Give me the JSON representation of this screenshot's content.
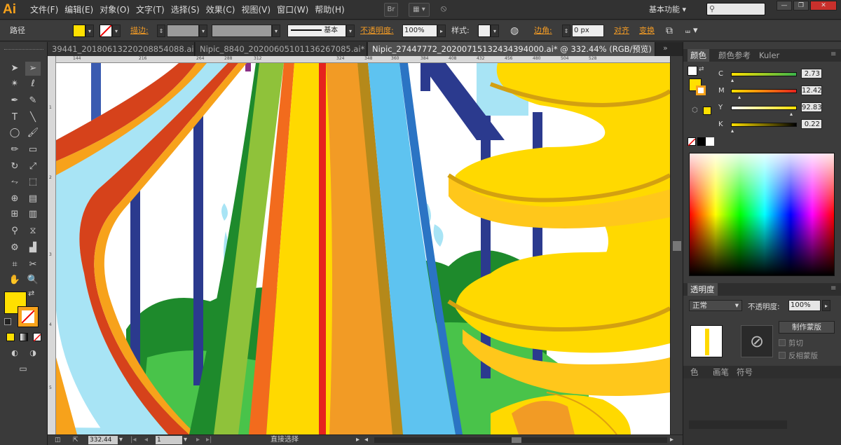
{
  "app": {
    "logo": "Ai"
  },
  "menu": [
    "文件(F)",
    "编辑(E)",
    "对象(O)",
    "文字(T)",
    "选择(S)",
    "效果(C)",
    "视图(V)",
    "窗口(W)",
    "帮助(H)"
  ],
  "menubar": {
    "bridge_label": "Br",
    "workspace": "基本功能",
    "search_placeholder": ""
  },
  "control_bar": {
    "selection_label": "路径",
    "stroke_label": "描边:",
    "stroke_style": "基本",
    "opacity_label": "不透明度:",
    "opacity_value": "100%",
    "style_label": "样式:",
    "corner_label": "边角:",
    "corner_value": "0 px",
    "align_label": "对齐",
    "transform_label": "变换"
  },
  "tabs": [
    {
      "label": "39441_20180613220208854088.ai*",
      "active": false
    },
    {
      "label": "Nipic_8840_20200605101136267085.ai*",
      "active": false
    },
    {
      "label": "Nipic_27447772_20200715132434394000.ai* @ 332.44% (RGB/预览)",
      "active": true
    }
  ],
  "ruler_top": [
    "144",
    "216",
    "264",
    "288",
    "312",
    "324",
    "348",
    "360",
    "384",
    "408",
    "432",
    "456",
    "480",
    "504",
    "528"
  ],
  "ruler_left": [
    "1",
    "2",
    "3",
    "4",
    "5"
  ],
  "status": {
    "zoom": "332.44",
    "artboard": "1",
    "tool": "直接选择"
  },
  "panels": {
    "color_tabs": [
      "颜色",
      "颜色参考",
      "Kuler"
    ],
    "cmyk": [
      {
        "label": "C",
        "value": "2.73",
        "level": 0.027
      },
      {
        "label": "M",
        "value": "12.42",
        "level": 0.124
      },
      {
        "label": "Y",
        "value": "92.83",
        "level": 0.928
      },
      {
        "label": "K",
        "value": "0.22",
        "level": 0.002
      }
    ],
    "transparency_tab": "透明度",
    "blend_mode": "正常",
    "opacity_label": "不透明度:",
    "opacity_value": "100%",
    "make_mask": "制作蒙版",
    "clip": "剪切",
    "invert_mask": "反相蒙版",
    "bottom_tabs": [
      "色",
      "画笔",
      "符号"
    ]
  },
  "colors": {
    "fill": "#ffe000",
    "stroke": "#f7a21b"
  }
}
